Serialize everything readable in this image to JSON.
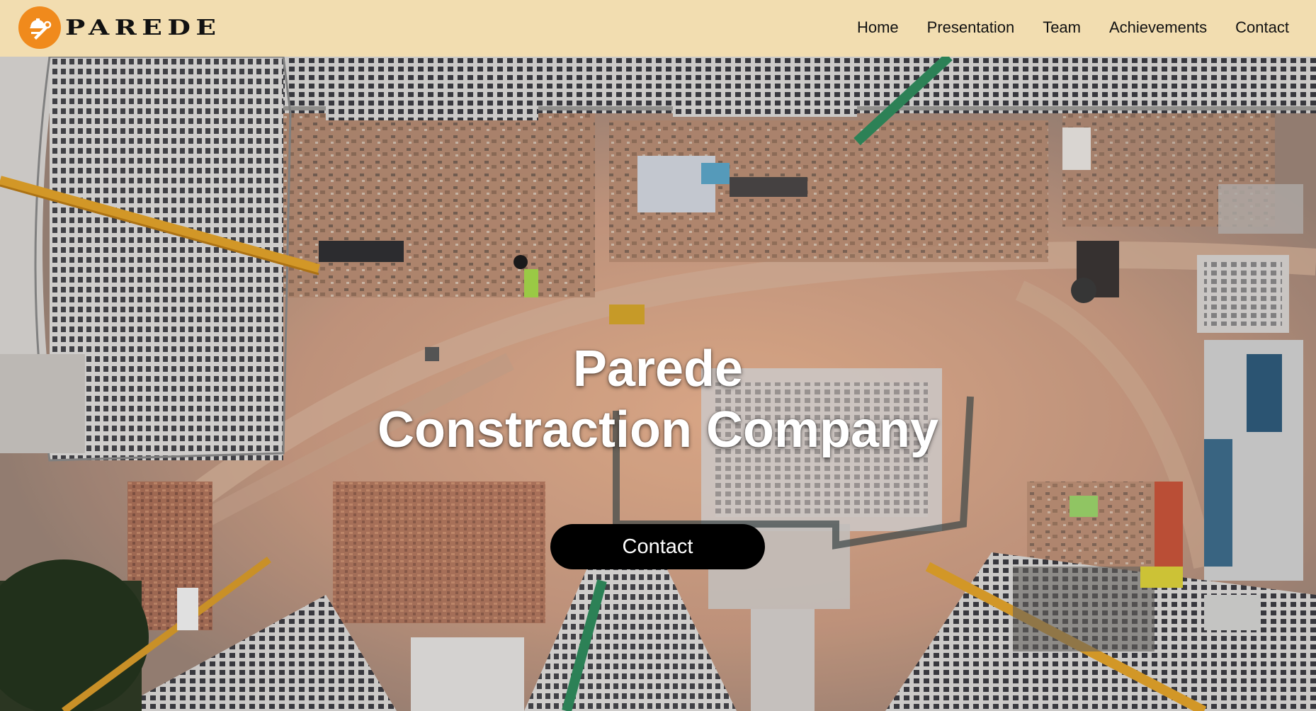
{
  "header": {
    "logo_text": "PAREDE",
    "logo_icon": "construction-tools-icon",
    "colors": {
      "background": "#f2ddb0",
      "logo_badge": "#f08a1c"
    }
  },
  "nav": {
    "items": [
      {
        "label": "Home"
      },
      {
        "label": "Presentation"
      },
      {
        "label": "Team"
      },
      {
        "label": "Achievements"
      },
      {
        "label": "Contact"
      }
    ]
  },
  "hero": {
    "title_line1": "Parede",
    "title_line2": "Constraction Company",
    "cta_label": "Contact",
    "background": "aerial-construction-site-image"
  }
}
